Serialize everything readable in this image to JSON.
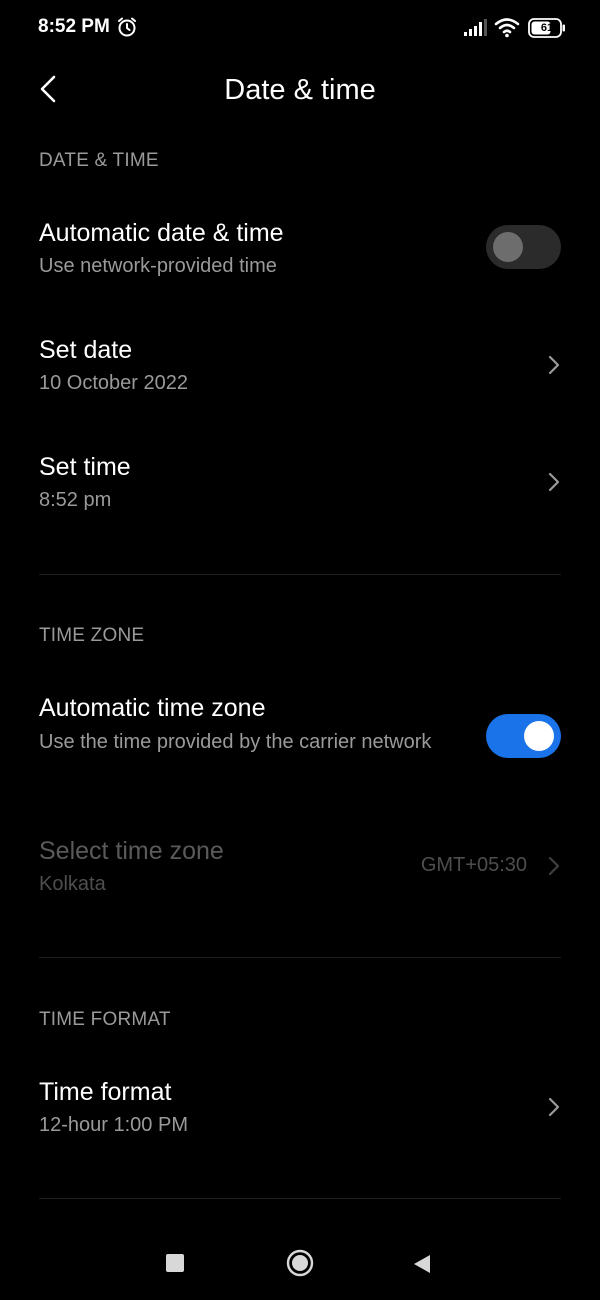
{
  "status_bar": {
    "time": "8:52 PM",
    "battery": "61"
  },
  "header": {
    "title": "Date & time"
  },
  "sections": {
    "date_time": {
      "header": "DATE & TIME",
      "automatic": {
        "title": "Automatic date & time",
        "subtitle": "Use network-provided time",
        "enabled": false
      },
      "set_date": {
        "title": "Set date",
        "value": "10 October 2022"
      },
      "set_time": {
        "title": "Set time",
        "value": "8:52 pm"
      }
    },
    "time_zone": {
      "header": "TIME ZONE",
      "automatic": {
        "title": "Automatic time zone",
        "subtitle": "Use the time provided by the carrier network",
        "enabled": true
      },
      "select": {
        "title": "Select time zone",
        "value": "Kolkata",
        "offset": "GMT+05:30"
      }
    },
    "time_format": {
      "header": "TIME FORMAT",
      "format": {
        "title": "Time format",
        "value": "12-hour 1:00 PM"
      }
    }
  },
  "colors": {
    "background": "#000000",
    "accent": "#1a73e8",
    "toggle_off_track": "#2b2b2b",
    "toggle_off_knob": "#6d6d6d",
    "secondary_text": "#9a9a9a"
  },
  "icons": {
    "alarm": "alarm-clock-icon",
    "signal": "signal-bars-icon",
    "wifi": "wifi-icon",
    "battery": "battery-icon",
    "back": "chevron-left-icon",
    "chevron": "chevron-right-icon",
    "nav_recents": "square-icon",
    "nav_home": "circle-icon",
    "nav_back": "triangle-back-icon"
  }
}
